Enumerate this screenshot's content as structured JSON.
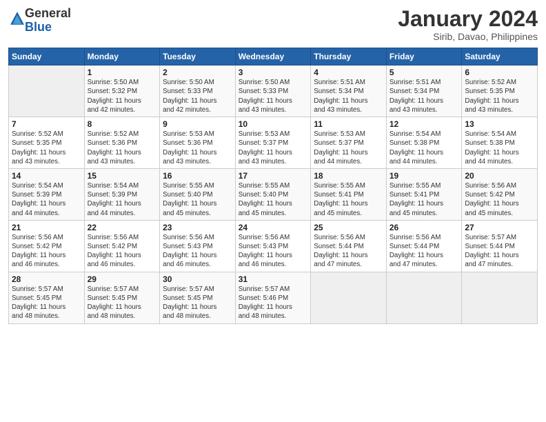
{
  "header": {
    "logo_general": "General",
    "logo_blue": "Blue",
    "calendar_title": "January 2024",
    "calendar_subtitle": "Sirib, Davao, Philippines"
  },
  "days_of_week": [
    "Sunday",
    "Monday",
    "Tuesday",
    "Wednesday",
    "Thursday",
    "Friday",
    "Saturday"
  ],
  "weeks": [
    [
      {
        "num": "",
        "info": ""
      },
      {
        "num": "1",
        "info": "Sunrise: 5:50 AM\nSunset: 5:32 PM\nDaylight: 11 hours\nand 42 minutes."
      },
      {
        "num": "2",
        "info": "Sunrise: 5:50 AM\nSunset: 5:33 PM\nDaylight: 11 hours\nand 42 minutes."
      },
      {
        "num": "3",
        "info": "Sunrise: 5:50 AM\nSunset: 5:33 PM\nDaylight: 11 hours\nand 43 minutes."
      },
      {
        "num": "4",
        "info": "Sunrise: 5:51 AM\nSunset: 5:34 PM\nDaylight: 11 hours\nand 43 minutes."
      },
      {
        "num": "5",
        "info": "Sunrise: 5:51 AM\nSunset: 5:34 PM\nDaylight: 11 hours\nand 43 minutes."
      },
      {
        "num": "6",
        "info": "Sunrise: 5:52 AM\nSunset: 5:35 PM\nDaylight: 11 hours\nand 43 minutes."
      }
    ],
    [
      {
        "num": "7",
        "info": "Sunrise: 5:52 AM\nSunset: 5:35 PM\nDaylight: 11 hours\nand 43 minutes."
      },
      {
        "num": "8",
        "info": "Sunrise: 5:52 AM\nSunset: 5:36 PM\nDaylight: 11 hours\nand 43 minutes."
      },
      {
        "num": "9",
        "info": "Sunrise: 5:53 AM\nSunset: 5:36 PM\nDaylight: 11 hours\nand 43 minutes."
      },
      {
        "num": "10",
        "info": "Sunrise: 5:53 AM\nSunset: 5:37 PM\nDaylight: 11 hours\nand 43 minutes."
      },
      {
        "num": "11",
        "info": "Sunrise: 5:53 AM\nSunset: 5:37 PM\nDaylight: 11 hours\nand 44 minutes."
      },
      {
        "num": "12",
        "info": "Sunrise: 5:54 AM\nSunset: 5:38 PM\nDaylight: 11 hours\nand 44 minutes."
      },
      {
        "num": "13",
        "info": "Sunrise: 5:54 AM\nSunset: 5:38 PM\nDaylight: 11 hours\nand 44 minutes."
      }
    ],
    [
      {
        "num": "14",
        "info": "Sunrise: 5:54 AM\nSunset: 5:39 PM\nDaylight: 11 hours\nand 44 minutes."
      },
      {
        "num": "15",
        "info": "Sunrise: 5:54 AM\nSunset: 5:39 PM\nDaylight: 11 hours\nand 44 minutes."
      },
      {
        "num": "16",
        "info": "Sunrise: 5:55 AM\nSunset: 5:40 PM\nDaylight: 11 hours\nand 45 minutes."
      },
      {
        "num": "17",
        "info": "Sunrise: 5:55 AM\nSunset: 5:40 PM\nDaylight: 11 hours\nand 45 minutes."
      },
      {
        "num": "18",
        "info": "Sunrise: 5:55 AM\nSunset: 5:41 PM\nDaylight: 11 hours\nand 45 minutes."
      },
      {
        "num": "19",
        "info": "Sunrise: 5:55 AM\nSunset: 5:41 PM\nDaylight: 11 hours\nand 45 minutes."
      },
      {
        "num": "20",
        "info": "Sunrise: 5:56 AM\nSunset: 5:42 PM\nDaylight: 11 hours\nand 45 minutes."
      }
    ],
    [
      {
        "num": "21",
        "info": "Sunrise: 5:56 AM\nSunset: 5:42 PM\nDaylight: 11 hours\nand 46 minutes."
      },
      {
        "num": "22",
        "info": "Sunrise: 5:56 AM\nSunset: 5:42 PM\nDaylight: 11 hours\nand 46 minutes."
      },
      {
        "num": "23",
        "info": "Sunrise: 5:56 AM\nSunset: 5:43 PM\nDaylight: 11 hours\nand 46 minutes."
      },
      {
        "num": "24",
        "info": "Sunrise: 5:56 AM\nSunset: 5:43 PM\nDaylight: 11 hours\nand 46 minutes."
      },
      {
        "num": "25",
        "info": "Sunrise: 5:56 AM\nSunset: 5:44 PM\nDaylight: 11 hours\nand 47 minutes."
      },
      {
        "num": "26",
        "info": "Sunrise: 5:56 AM\nSunset: 5:44 PM\nDaylight: 11 hours\nand 47 minutes."
      },
      {
        "num": "27",
        "info": "Sunrise: 5:57 AM\nSunset: 5:44 PM\nDaylight: 11 hours\nand 47 minutes."
      }
    ],
    [
      {
        "num": "28",
        "info": "Sunrise: 5:57 AM\nSunset: 5:45 PM\nDaylight: 11 hours\nand 48 minutes."
      },
      {
        "num": "29",
        "info": "Sunrise: 5:57 AM\nSunset: 5:45 PM\nDaylight: 11 hours\nand 48 minutes."
      },
      {
        "num": "30",
        "info": "Sunrise: 5:57 AM\nSunset: 5:45 PM\nDaylight: 11 hours\nand 48 minutes."
      },
      {
        "num": "31",
        "info": "Sunrise: 5:57 AM\nSunset: 5:46 PM\nDaylight: 11 hours\nand 48 minutes."
      },
      {
        "num": "",
        "info": ""
      },
      {
        "num": "",
        "info": ""
      },
      {
        "num": "",
        "info": ""
      }
    ]
  ]
}
